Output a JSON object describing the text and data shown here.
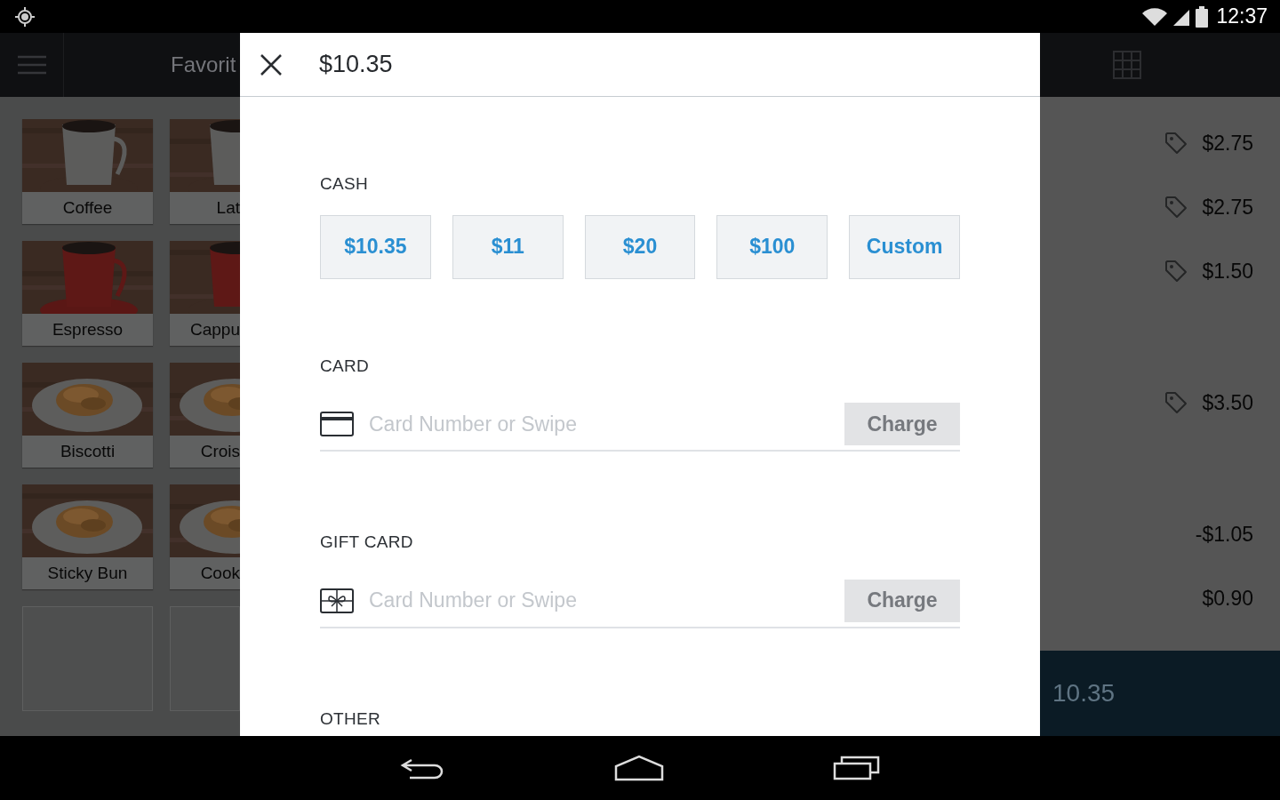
{
  "status_bar": {
    "time": "12:37"
  },
  "app_bar": {
    "title": "Favorit"
  },
  "tiles": [
    {
      "kind": "item",
      "label": "Coffee"
    },
    {
      "kind": "item",
      "label": "Lat"
    },
    {
      "kind": "item",
      "label": "Espresso"
    },
    {
      "kind": "item",
      "label": "Cappu"
    },
    {
      "kind": "item",
      "label": "Biscotti"
    },
    {
      "kind": "item",
      "label": "Crois"
    },
    {
      "kind": "item",
      "label": "Sticky Bun"
    },
    {
      "kind": "item",
      "label": "Cook"
    },
    {
      "kind": "empty"
    },
    {
      "kind": "empty"
    }
  ],
  "order_lines": [
    {
      "kind": "item",
      "price": "$2.75"
    },
    {
      "kind": "item",
      "price": "$2.75"
    },
    {
      "kind": "item",
      "price": "$1.50"
    },
    {
      "kind": "item",
      "price": "$3.50"
    },
    {
      "kind": "adjustment",
      "price": "-$1.05"
    },
    {
      "kind": "adjustment",
      "price": "$0.90"
    }
  ],
  "charge_bar": {
    "amount": "10.35"
  },
  "dialog": {
    "title": "$10.35",
    "sections": [
      {
        "kind": "cash",
        "label": "CASH",
        "amounts": [
          "$10.35",
          "$11",
          "$20",
          "$100",
          "Custom"
        ]
      },
      {
        "kind": "card",
        "label": "CARD",
        "placeholder": "Card Number or Swipe",
        "button": "Charge",
        "disabled": true
      },
      {
        "kind": "gift",
        "label": "GIFT CARD",
        "placeholder": "Card Number or Swipe",
        "button": "Charge",
        "disabled": true
      },
      {
        "kind": "other",
        "label": "OTHER"
      }
    ]
  }
}
